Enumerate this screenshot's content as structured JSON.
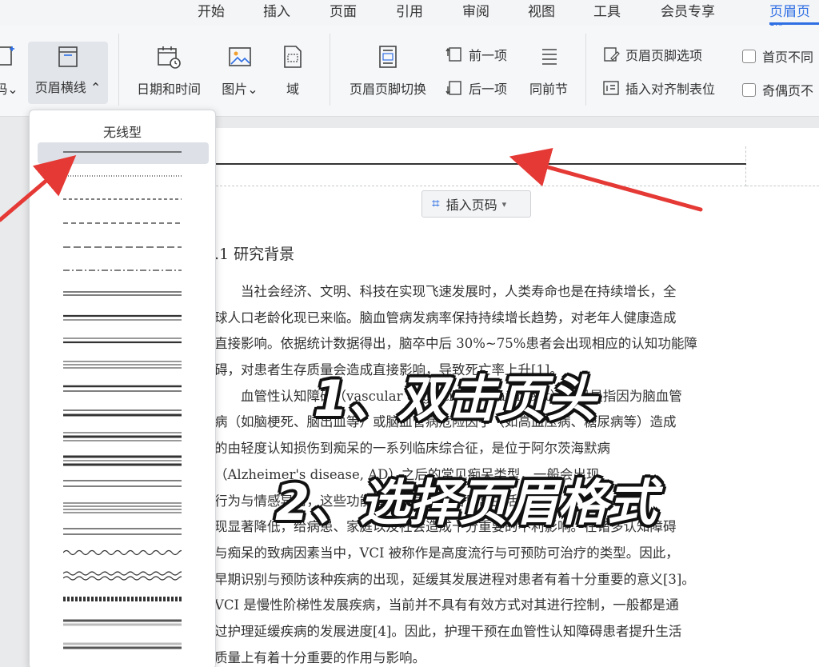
{
  "menu": {
    "tabs": [
      {
        "label": "开始"
      },
      {
        "label": "插入"
      },
      {
        "label": "页面"
      },
      {
        "label": "引用"
      },
      {
        "label": "审阅"
      },
      {
        "label": "视图"
      },
      {
        "label": "工具"
      },
      {
        "label": "会员专享"
      },
      {
        "label": "页眉页脚"
      }
    ]
  },
  "ribbon": {
    "page_number": "码",
    "header_line": "页眉横线",
    "date_time": "日期和时间",
    "picture": "图片",
    "field": "域",
    "switch_header_footer": "页眉页脚切换",
    "previous": "前一项",
    "next": "后一项",
    "same_as_previous": "同前节",
    "header_footer_options": "页眉页脚选项",
    "insert_align_tab": "插入对齐制表位",
    "first_page_different": "首页不同",
    "odd_even_different": "奇偶页不"
  },
  "dropdown": {
    "title": "无线型"
  },
  "document": {
    "insert_page_number": "插入页码",
    "heading": ".1  研究背景",
    "paragraph_lines": [
      "　　当社会经济、文明、科技在实现飞速发展时，人类寿命也是在持续增长，全",
      "球人口老龄化现已来临。脑血管病发病率保持持续增长趋势，对老年人健康造成",
      "直接影响。依据统计数据得出，脑卒中后 30%~75%患者会出现相应的认知功能障",
      "碍，对患者生存质量会造成直接影响，导致死亡率上升[1]。",
      "　　血管性认知障碍（vascular cognitive impairment）一般是指因为脑血管",
      "病（如脑梗死、脑出血等）或脑血管病危险因子（如高血压病、糖尿病等）造成",
      "的由轻度认知损伤到痴呆的一系列临床综合征，是位于阿尔茨海默病",
      "（Alzheimer's disease, AD）之后的常见痴呆类型，一般会出现",
      "行为与情感异常，这些功能障碍会导致患者日常生活能力出",
      "现显著降低，给病患、家庭以及社会造成十分重要的不利影响。在诸多认知障碍",
      "与痴呆的致病因素当中，VCI 被称作是高度流行与可预防可治疗的类型。因此，",
      "早期识别与预防该种疾病的出现，延缓其发展进程对患者有着十分重要的意义[3]。",
      "VCI 是慢性阶梯性发展疾病，当前并不具有有效方式对其进行控制，一般都是通",
      "过护理延缓疾病的发展进度[4]。因此，护理干预在血管性认知障碍患者提升生活",
      "质量上有着十分重要的作用与影响。"
    ]
  },
  "overlay": {
    "step1": "1、双击页头",
    "step2": "2、选择页眉格式"
  },
  "colors": {
    "accent": "#2f6fe4",
    "arrow": "#e53935"
  }
}
